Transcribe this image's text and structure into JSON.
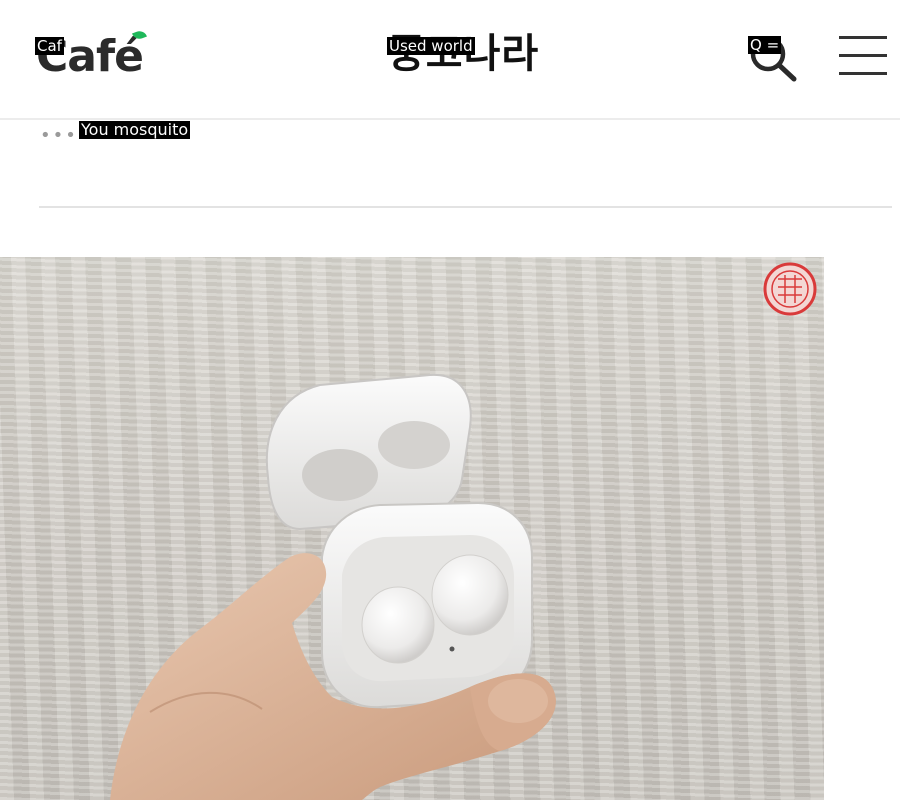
{
  "header": {
    "logo_text": "Café",
    "logo_ocr_tag": "Caf",
    "title_korean": "중고나라",
    "title_ocr_tag": "Used world",
    "search_ocr_tag": "Q =",
    "icons": {
      "search": "search-icon",
      "menu": "hamburger-menu-icon"
    }
  },
  "subheader": {
    "more_icon": "more-dots-icon",
    "title_ocr_tag": "You mosquito"
  },
  "colors": {
    "logo_text": "#2b2b2b",
    "logo_accent": "#1fb85a",
    "divider": "#e3e3e3",
    "stamp": "#d93a3a"
  },
  "product_image": {
    "subject": "white wireless earbuds in open charging case held in hand"
  }
}
